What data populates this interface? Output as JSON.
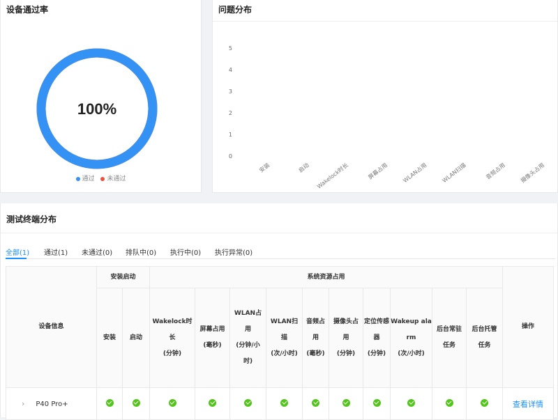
{
  "pass_card": {
    "title": "设备通过率",
    "percent_text": "100%",
    "pass_rate": 1.0,
    "legend": [
      {
        "label": "通过",
        "color": "#3592f5"
      },
      {
        "label": "未通过",
        "color": "#e8523f"
      }
    ]
  },
  "issue_card": {
    "title": "问题分布"
  },
  "chart_data": {
    "type": "bar",
    "title": "问题分布",
    "categories": [
      "安装",
      "启动",
      "Wakelock时长",
      "屏幕占用",
      "WLAN占用",
      "WLAN扫描",
      "音频占用",
      "摄像头占用"
    ],
    "values": [
      0,
      0,
      0,
      0,
      0,
      0,
      0,
      0
    ],
    "ylim": [
      0,
      5
    ],
    "yticks": [
      "0",
      "1",
      "2",
      "3",
      "4",
      "5"
    ],
    "grid": false
  },
  "terminal_card": {
    "title": "测试终端分布",
    "tabs": [
      "全部(1)",
      "通过(1)",
      "未通过(0)",
      "排队中(0)",
      "执行中(0)",
      "执行异常(0)"
    ],
    "active_tab": 0,
    "table": {
      "device_header": "设备信息",
      "group_install": "安装启动",
      "group_resource": "系统资源占用",
      "action_header": "操作",
      "columns": [
        {
          "lines": [
            "安装"
          ]
        },
        {
          "lines": [
            "启动"
          ]
        },
        {
          "lines": [
            "Wakelock时",
            "长",
            "(分钟)"
          ]
        },
        {
          "lines": [
            "屏幕占用",
            "(毫秒)"
          ]
        },
        {
          "lines": [
            "WLAN占",
            "用",
            "(分钟/小",
            "时)"
          ]
        },
        {
          "lines": [
            "WLAN扫",
            "描",
            "(次/小时)"
          ]
        },
        {
          "lines": [
            "音频占",
            "用",
            "(毫秒)"
          ]
        },
        {
          "lines": [
            "摄像头占",
            "用",
            "(分钟)"
          ]
        },
        {
          "lines": [
            "定位传感",
            "器",
            "(分钟)"
          ]
        },
        {
          "lines": [
            "Wakeup ala",
            "rm",
            "(次/小时)"
          ]
        },
        {
          "lines": [
            "后台常驻",
            "任务"
          ]
        },
        {
          "lines": [
            "后台托管",
            "任务"
          ]
        }
      ],
      "rows": [
        {
          "device": "P40 Pro+",
          "results": [
            "pass",
            "pass",
            "pass",
            "pass",
            "pass",
            "pass",
            "pass",
            "pass",
            "pass",
            "pass",
            "pass",
            "pass"
          ],
          "action": "查看详情"
        }
      ]
    }
  }
}
